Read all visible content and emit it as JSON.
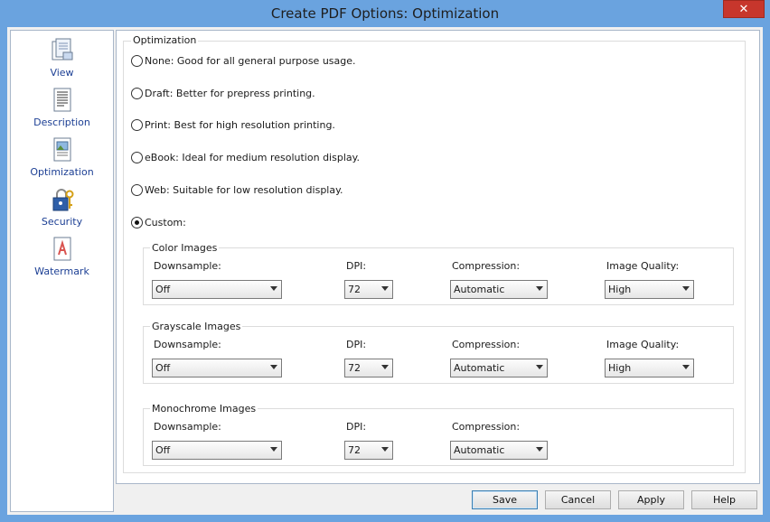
{
  "window": {
    "title": "Create PDF Options: Optimization",
    "close_label": "✕"
  },
  "sidebar": {
    "items": [
      {
        "label": "View",
        "icon": "page-view-icon"
      },
      {
        "label": "Description",
        "icon": "document-description-icon"
      },
      {
        "label": "Optimization",
        "icon": "image-document-icon"
      },
      {
        "label": "Security",
        "icon": "lock-key-icon"
      },
      {
        "label": "Watermark",
        "icon": "watermark-page-icon"
      }
    ]
  },
  "optimization": {
    "group_title": "Optimization",
    "options": [
      {
        "label": "None: Good for all general purpose usage.",
        "checked": false
      },
      {
        "label": "Draft: Better for prepress printing.",
        "checked": false
      },
      {
        "label": "Print: Best for high resolution printing.",
        "checked": false
      },
      {
        "label": "eBook: Ideal for medium resolution display.",
        "checked": false
      },
      {
        "label": "Web: Suitable for low resolution display.",
        "checked": false
      },
      {
        "label": "Custom:",
        "checked": true
      }
    ]
  },
  "color_images": {
    "title": "Color Images",
    "downsample_label": "Downsample:",
    "downsample_value": "Off",
    "dpi_label": "DPI:",
    "dpi_value": "72",
    "compression_label": "Compression:",
    "compression_value": "Automatic",
    "quality_label": "Image Quality:",
    "quality_value": "High"
  },
  "grayscale_images": {
    "title": "Grayscale Images",
    "downsample_label": "Downsample:",
    "downsample_value": "Off",
    "dpi_label": "DPI:",
    "dpi_value": "72",
    "compression_label": "Compression:",
    "compression_value": "Automatic",
    "quality_label": "Image Quality:",
    "quality_value": "High"
  },
  "monochrome_images": {
    "title": "Monochrome Images",
    "downsample_label": "Downsample:",
    "downsample_value": "Off",
    "dpi_label": "DPI:",
    "dpi_value": "72",
    "compression_label": "Compression:",
    "compression_value": "Automatic"
  },
  "buttons": {
    "save": "Save",
    "cancel": "Cancel",
    "apply": "Apply",
    "help": "Help"
  }
}
